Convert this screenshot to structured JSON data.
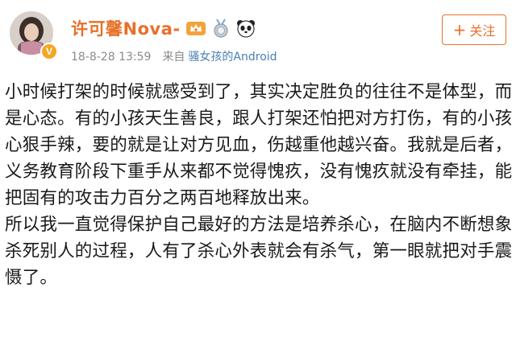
{
  "post": {
    "author": "许可馨Nova-",
    "timestamp": "18-8-28 13:59",
    "via_prefix": "来自",
    "client": "骚女孩的Android",
    "follow_label": "关注",
    "follow_icon": "plus-icon",
    "badges": [
      "crown-badge-icon",
      "medal-badge-icon",
      "panda-icon"
    ],
    "avatar_badge": "V",
    "text": "小时候打架的时候就感受到了，其实决定胜负的往往不是体型，而是心态。有的小孩天生善良，跟人打架还怕把对方打伤，有的小孩心狠手辣，要的就是让对方见血，伤越重他越兴奋。我就是后者，义务教育阶段下重手从来都不觉得愧疚，没有愧疚就没有牵挂，能把固有的攻击力百分之两百地释放出来。\n所以我一直觉得保护自己最好的方法是培养杀心，在脑内不断想象杀死别人的过程，人有了杀心外表就会有杀气，第一眼就把对手震慑了。"
  },
  "colors": {
    "accent": "#e8702a",
    "link": "#4a7fb5",
    "meta": "#8a8a8a"
  }
}
